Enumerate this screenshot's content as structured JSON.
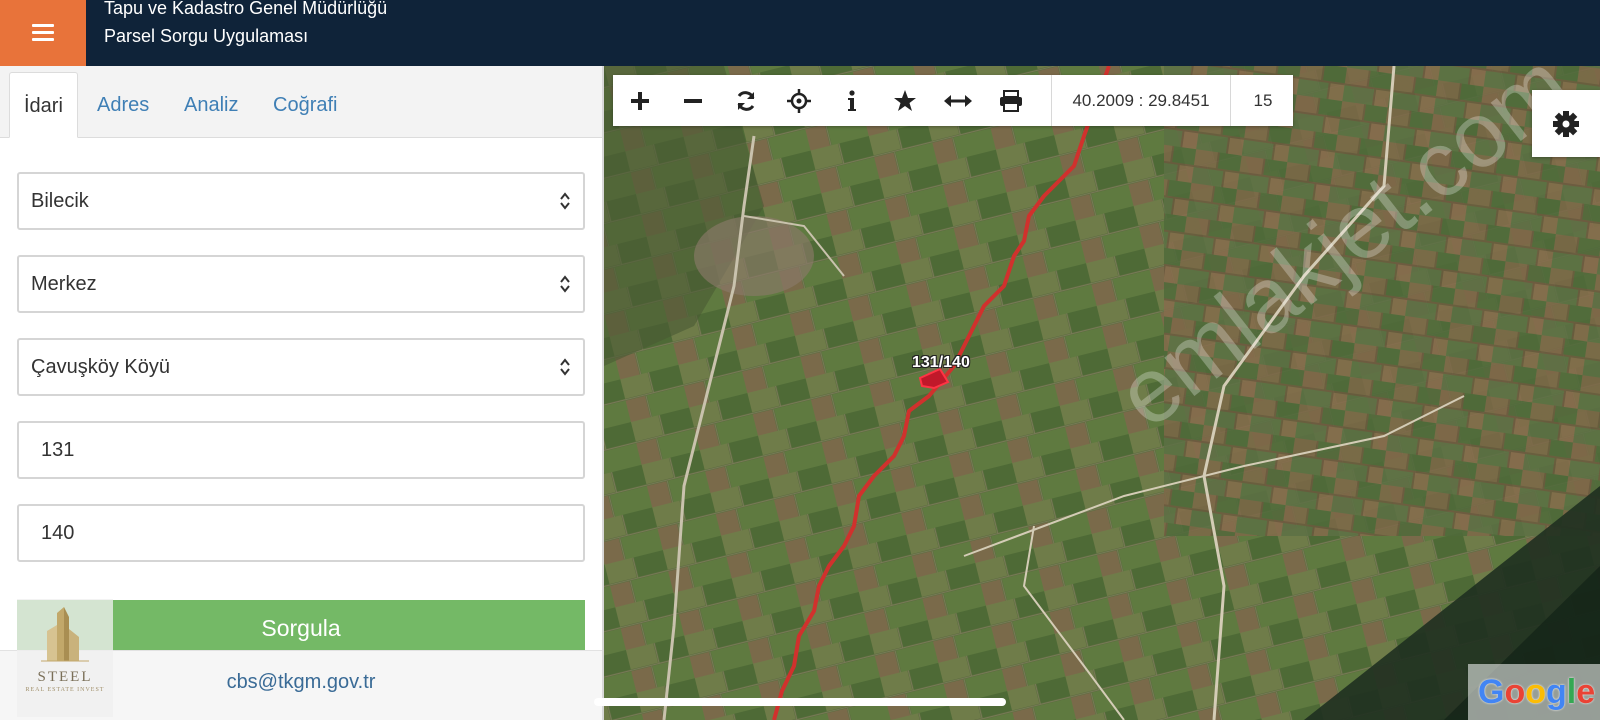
{
  "header": {
    "menu_icon": "hamburger-icon",
    "title": "Tapu ve Kadastro Genel Müdürlüğü",
    "subtitle": "Parsel Sorgu Uygulaması"
  },
  "tabs": [
    {
      "label": "İdari",
      "active": true
    },
    {
      "label": "Adres",
      "active": false
    },
    {
      "label": "Analiz",
      "active": false
    },
    {
      "label": "Coğrafi",
      "active": false
    }
  ],
  "form": {
    "province": "Bilecik",
    "district": "Merkez",
    "neighborhood": "Çavuşköy Köyü",
    "block": "131",
    "parcel": "140",
    "submit_label": "Sorgula"
  },
  "footer": {
    "email": "cbs@tkgm.gov.tr",
    "logo_name": "STEEL",
    "logo_tagline": "REAL ESTATE INVEST"
  },
  "map": {
    "toolbar_icons": [
      "plus-icon",
      "minus-icon",
      "refresh-icon",
      "crosshair-icon",
      "info-icon",
      "star-icon",
      "measure-icon",
      "print-icon"
    ],
    "coordinates": "40.2009 : 29.8451",
    "zoom_level": "15",
    "settings_icon": "gear-icon",
    "parcel_label": "131/140",
    "watermark": "emlakjet.com",
    "provider": "Google",
    "colors": {
      "boundary": "#d0312d",
      "toolbar_bg": "#ffffff"
    }
  },
  "colors": {
    "header_bg": "#0f2339",
    "menu_bg": "#e8733a",
    "submit_bg": "#74b966",
    "link": "#3f7fb5"
  }
}
